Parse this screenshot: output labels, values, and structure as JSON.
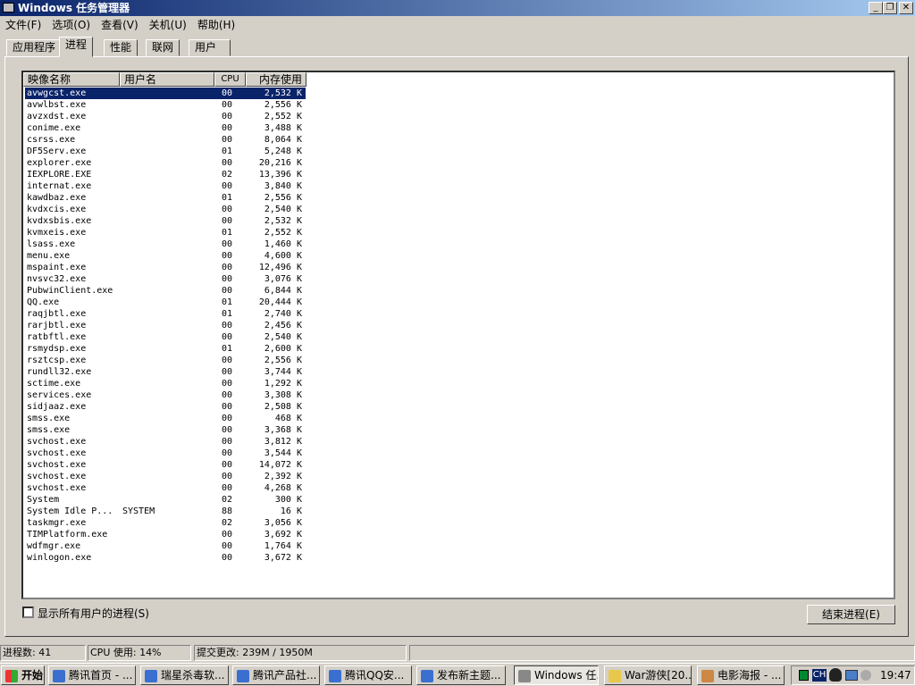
{
  "window": {
    "title": "Windows 任务管理器",
    "min": "_",
    "max": "❐",
    "close": "✕"
  },
  "menu": [
    "文件(F)",
    "选项(O)",
    "查看(V)",
    "关机(U)",
    "帮助(H)"
  ],
  "tabs": [
    "应用程序",
    "进程",
    "性能",
    "联网",
    "用户"
  ],
  "columns": [
    "映像名称",
    "用户名",
    "CPU",
    "内存使用"
  ],
  "processes": [
    [
      "avwgcst.exe",
      "",
      "00",
      "2,532 K"
    ],
    [
      "avwlbst.exe",
      "",
      "00",
      "2,556 K"
    ],
    [
      "avzxdst.exe",
      "",
      "00",
      "2,552 K"
    ],
    [
      "conime.exe",
      "",
      "00",
      "3,488 K"
    ],
    [
      "csrss.exe",
      "",
      "00",
      "8,064 K"
    ],
    [
      "DF5Serv.exe",
      "",
      "01",
      "5,248 K"
    ],
    [
      "explorer.exe",
      "",
      "00",
      "20,216 K"
    ],
    [
      "IEXPLORE.EXE",
      "",
      "02",
      "13,396 K"
    ],
    [
      "internat.exe",
      "",
      "00",
      "3,840 K"
    ],
    [
      "kawdbaz.exe",
      "",
      "01",
      "2,556 K"
    ],
    [
      "kvdxcis.exe",
      "",
      "00",
      "2,540 K"
    ],
    [
      "kvdxsbis.exe",
      "",
      "00",
      "2,532 K"
    ],
    [
      "kvmxeis.exe",
      "",
      "01",
      "2,552 K"
    ],
    [
      "lsass.exe",
      "",
      "00",
      "1,460 K"
    ],
    [
      "menu.exe",
      "",
      "00",
      "4,600 K"
    ],
    [
      "mspaint.exe",
      "",
      "00",
      "12,496 K"
    ],
    [
      "nvsvc32.exe",
      "",
      "00",
      "3,076 K"
    ],
    [
      "PubwinClient.exe",
      "",
      "00",
      "6,844 K"
    ],
    [
      "QQ.exe",
      "",
      "01",
      "20,444 K"
    ],
    [
      "raqjbtl.exe",
      "",
      "01",
      "2,740 K"
    ],
    [
      "rarjbtl.exe",
      "",
      "00",
      "2,456 K"
    ],
    [
      "ratbftl.exe",
      "",
      "00",
      "2,540 K"
    ],
    [
      "rsmydsp.exe",
      "",
      "01",
      "2,600 K"
    ],
    [
      "rsztcsp.exe",
      "",
      "00",
      "2,556 K"
    ],
    [
      "rundll32.exe",
      "",
      "00",
      "3,744 K"
    ],
    [
      "sctime.exe",
      "",
      "00",
      "1,292 K"
    ],
    [
      "services.exe",
      "",
      "00",
      "3,308 K"
    ],
    [
      "sidjaaz.exe",
      "",
      "00",
      "2,508 K"
    ],
    [
      "smss.exe",
      "",
      "00",
      "468 K"
    ],
    [
      "smss.exe",
      "",
      "00",
      "3,368 K"
    ],
    [
      "svchost.exe",
      "",
      "00",
      "3,812 K"
    ],
    [
      "svchost.exe",
      "",
      "00",
      "3,544 K"
    ],
    [
      "svchost.exe",
      "",
      "00",
      "14,072 K"
    ],
    [
      "svchost.exe",
      "",
      "00",
      "2,392 K"
    ],
    [
      "svchost.exe",
      "",
      "00",
      "4,268 K"
    ],
    [
      "System",
      "",
      "02",
      "300 K"
    ],
    [
      "System Idle P...",
      "SYSTEM",
      "88",
      "16 K"
    ],
    [
      "taskmgr.exe",
      "",
      "02",
      "3,056 K"
    ],
    [
      "TIMPlatform.exe",
      "",
      "00",
      "3,692 K"
    ],
    [
      "wdfmgr.exe",
      "",
      "00",
      "1,764 K"
    ],
    [
      "winlogon.exe",
      "",
      "00",
      "3,672 K"
    ]
  ],
  "show_all_label": "显示所有用户的进程(S)",
  "end_process_label": "结束进程(E)",
  "status": [
    "进程数: 41",
    "CPU 使用: 14%",
    "提交更改: 239M / 1950M"
  ],
  "taskbar": {
    "start": "开始",
    "tasks": [
      "腾讯首页 - ...",
      "瑞星杀毒软...",
      "腾讯产品社...",
      "腾讯QQ安...",
      "发布新主题...",
      "Windows 任...",
      "War游侠[20...",
      "电影海报 - ..."
    ],
    "lang": "CH",
    "clock": "19:47"
  }
}
